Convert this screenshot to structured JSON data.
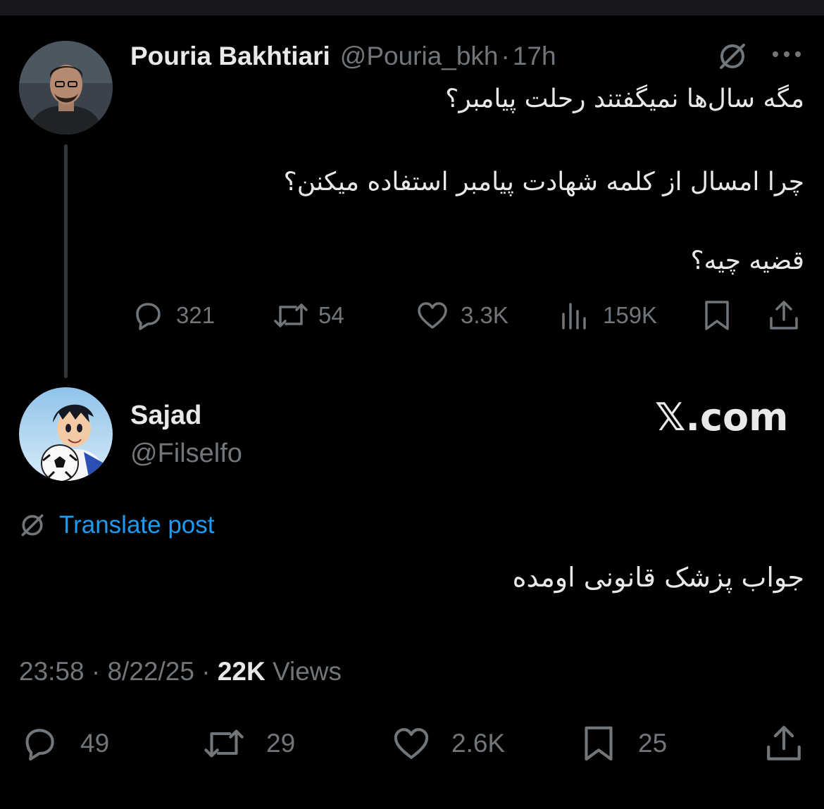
{
  "parent_post": {
    "author_name": "Pouria Bakhtiari",
    "author_handle": "@Pouria_bkh",
    "separator": "·",
    "time": "17h",
    "lines": [
      "مگه سال‌ها نمیگفتند رحلت پیامبر؟",
      "چرا امسال از کلمه شهادت پیامبر استفاده میکنن؟",
      "قضیه چیه؟"
    ],
    "stats": {
      "replies": "321",
      "reposts": "54",
      "likes": "3.3K",
      "views": "159K"
    }
  },
  "reply_post": {
    "author_name": "Sajad",
    "author_handle": "@Filselfo",
    "watermark": "𝕏.com",
    "translate_label": "Translate post",
    "text": "جواب پزشک قانونی اومده",
    "time": "23:58",
    "date": "8/22/25",
    "dot": "·",
    "views_count": "22K",
    "views_label": "Views",
    "stats": {
      "replies": "49",
      "reposts": "29",
      "likes": "2.6K",
      "bookmarks": "25"
    }
  },
  "colors": {
    "background": "#000000",
    "text": "#e7e9ea",
    "secondary": "#71767b",
    "link": "#1d9bf0"
  },
  "icons": [
    "translate-icon",
    "more-icon",
    "reply-icon",
    "repost-icon",
    "like-icon",
    "views-icon",
    "bookmark-icon",
    "share-icon"
  ]
}
